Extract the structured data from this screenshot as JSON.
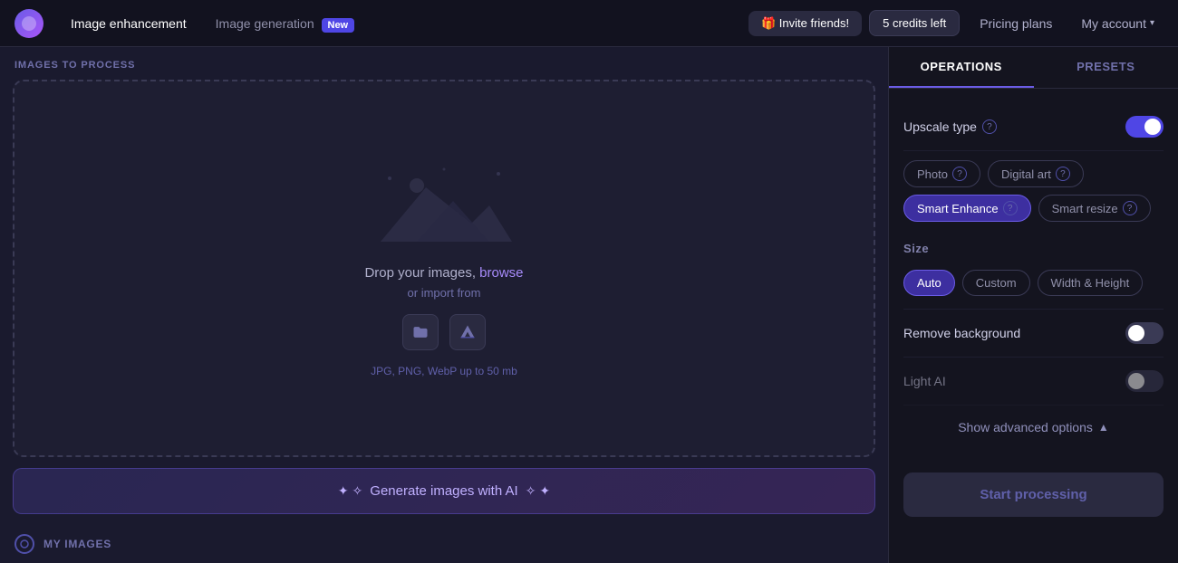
{
  "header": {
    "logo_alt": "Logo",
    "nav": [
      {
        "id": "image-enhancement",
        "label": "Image enhancement",
        "active": true
      },
      {
        "id": "image-generation",
        "label": "Image generation",
        "active": false
      }
    ],
    "new_badge": "New",
    "invite_label": "🎁 Invite friends!",
    "credits_label": "5 credits left",
    "pricing_label": "Pricing plans",
    "account_label": "My account",
    "chevron": "▾"
  },
  "left": {
    "section_label": "IMAGES TO PROCESS",
    "drop": {
      "main_text_before": "Drop your images, ",
      "browse_link": "browse",
      "or_import": "or import from",
      "import_icons": [
        {
          "id": "folder-icon",
          "symbol": "📁"
        },
        {
          "id": "drive-icon",
          "symbol": "▲"
        }
      ],
      "file_types": "JPG, PNG, WebP up to 50 mb"
    },
    "generate_btn": "Generate images with AI",
    "sparkle_left": "✦ ✧",
    "sparkle_right": "✧ ✦",
    "my_images_label": "MY IMAGES"
  },
  "right": {
    "tabs": [
      {
        "id": "operations",
        "label": "OPERATIONS",
        "active": true
      },
      {
        "id": "presets",
        "label": "PRESETS",
        "active": false
      }
    ],
    "upscale": {
      "label": "Upscale type",
      "toggle_on": true,
      "chips": [
        {
          "id": "photo",
          "label": "Photo",
          "active": false
        },
        {
          "id": "digital-art",
          "label": "Digital art",
          "active": false
        },
        {
          "id": "smart-enhance",
          "label": "Smart Enhance",
          "active": true
        },
        {
          "id": "smart-resize",
          "label": "Smart resize",
          "active": false
        }
      ]
    },
    "size": {
      "label": "Size",
      "chips": [
        {
          "id": "auto",
          "label": "Auto",
          "active": true
        },
        {
          "id": "custom",
          "label": "Custom",
          "active": false
        },
        {
          "id": "width-height",
          "label": "Width & Height",
          "active": false
        }
      ]
    },
    "remove_bg": {
      "label": "Remove background",
      "toggle_on": false
    },
    "light_ai": {
      "label": "Light AI",
      "toggle_on": false
    },
    "advanced_label": "Show advanced options",
    "start_label": "Start processing"
  }
}
